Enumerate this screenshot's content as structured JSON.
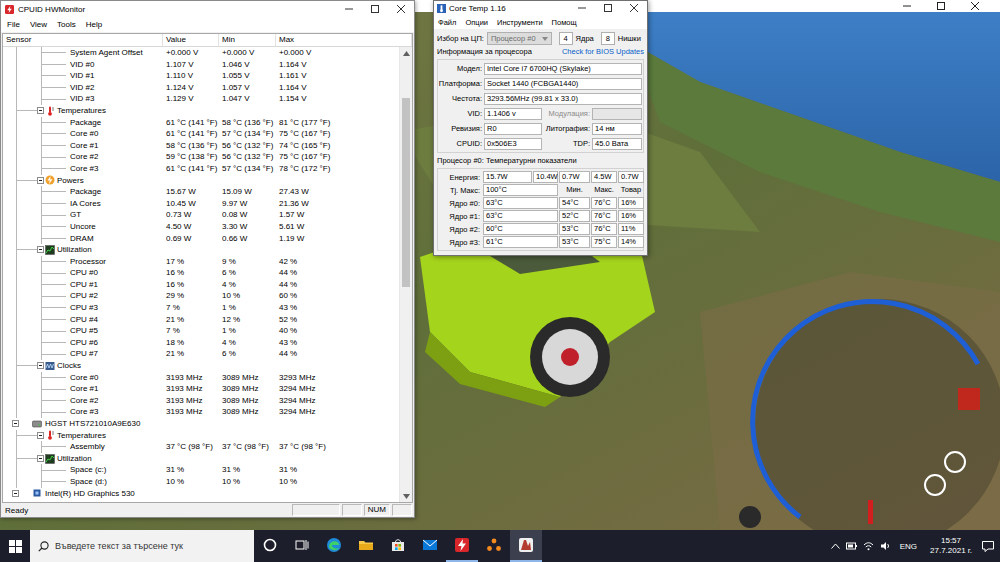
{
  "hwmonitor": {
    "title": "CPUID HWMonitor",
    "menu": [
      "File",
      "View",
      "Tools",
      "Help"
    ],
    "columns": [
      "Sensor",
      "Value",
      "Min",
      "Max"
    ],
    "rows": [
      {
        "kind": "sensor",
        "label": "System Agent Offset",
        "value": "+0.000 V",
        "min": "+0.000 V",
        "max": "+0.000 V"
      },
      {
        "kind": "sensor",
        "label": "VID #0",
        "value": "1.107 V",
        "min": "1.046 V",
        "max": "1.164 V"
      },
      {
        "kind": "sensor",
        "label": "VID #1",
        "value": "1.110 V",
        "min": "1.055 V",
        "max": "1.161 V"
      },
      {
        "kind": "sensor",
        "label": "VID #2",
        "value": "1.124 V",
        "min": "1.057 V",
        "max": "1.164 V"
      },
      {
        "kind": "sensor",
        "label": "VID #3",
        "value": "1.129 V",
        "min": "1.047 V",
        "max": "1.154 V"
      },
      {
        "kind": "temperatures",
        "label": "Temperatures",
        "expanded": true
      },
      {
        "kind": "sensor",
        "label": "Package",
        "value": "61 °C (141 °F)",
        "min": "58 °C (136 °F)",
        "max": "81 °C (177 °F)"
      },
      {
        "kind": "sensor",
        "label": "Core #0",
        "value": "61 °C (141 °F)",
        "min": "57 °C (134 °F)",
        "max": "75 °C (167 °F)"
      },
      {
        "kind": "sensor",
        "label": "Core #1",
        "value": "58 °C (136 °F)",
        "min": "56 °C (132 °F)",
        "max": "74 °C (165 °F)"
      },
      {
        "kind": "sensor",
        "label": "Core #2",
        "value": "59 °C (138 °F)",
        "min": "56 °C (132 °F)",
        "max": "75 °C (167 °F)"
      },
      {
        "kind": "sensor",
        "label": "Core #3",
        "value": "61 °C (141 °F)",
        "min": "57 °C (134 °F)",
        "max": "78 °C (172 °F)"
      },
      {
        "kind": "powers",
        "label": "Powers",
        "expanded": true
      },
      {
        "kind": "sensor",
        "label": "Package",
        "value": "15.67 W",
        "min": "15.09 W",
        "max": "27.43 W"
      },
      {
        "kind": "sensor",
        "label": "IA Cores",
        "value": "10.45 W",
        "min": "9.97 W",
        "max": "21.36 W"
      },
      {
        "kind": "sensor",
        "label": "GT",
        "value": "0.73 W",
        "min": "0.08 W",
        "max": "1.57 W"
      },
      {
        "kind": "sensor",
        "label": "Uncore",
        "value": "4.50 W",
        "min": "3.30 W",
        "max": "5.61 W"
      },
      {
        "kind": "sensor",
        "label": "DRAM",
        "value": "0.69 W",
        "min": "0.66 W",
        "max": "1.19 W"
      },
      {
        "kind": "utilization",
        "label": "Utilization",
        "expanded": true
      },
      {
        "kind": "sensor",
        "label": "Processor",
        "value": "17 %",
        "min": "9 %",
        "max": "42 %"
      },
      {
        "kind": "sensor",
        "label": "CPU #0",
        "value": "16 %",
        "min": "6 %",
        "max": "44 %"
      },
      {
        "kind": "sensor",
        "label": "CPU #1",
        "value": "16 %",
        "min": "4 %",
        "max": "44 %"
      },
      {
        "kind": "sensor",
        "label": "CPU #2",
        "value": "29 %",
        "min": "10 %",
        "max": "60 %"
      },
      {
        "kind": "sensor",
        "label": "CPU #3",
        "value": "7 %",
        "min": "1 %",
        "max": "43 %"
      },
      {
        "kind": "sensor",
        "label": "CPU #4",
        "value": "21 %",
        "min": "12 %",
        "max": "52 %"
      },
      {
        "kind": "sensor",
        "label": "CPU #5",
        "value": "7 %",
        "min": "1 %",
        "max": "40 %"
      },
      {
        "kind": "sensor",
        "label": "CPU #6",
        "value": "18 %",
        "min": "4 %",
        "max": "43 %"
      },
      {
        "kind": "sensor",
        "label": "CPU #7",
        "value": "21 %",
        "min": "6 %",
        "max": "44 %"
      },
      {
        "kind": "clocks",
        "label": "Clocks",
        "expanded": true
      },
      {
        "kind": "sensor",
        "label": "Core #0",
        "value": "3193 MHz",
        "min": "3089 MHz",
        "max": "3293 MHz"
      },
      {
        "kind": "sensor",
        "label": "Core #1",
        "value": "3193 MHz",
        "min": "3089 MHz",
        "max": "3294 MHz"
      },
      {
        "kind": "sensor",
        "label": "Core #2",
        "value": "3193 MHz",
        "min": "3089 MHz",
        "max": "3294 MHz"
      },
      {
        "kind": "sensor",
        "label": "Core #3",
        "value": "3193 MHz",
        "min": "3089 MHz",
        "max": "3294 MHz"
      },
      {
        "kind": "drive",
        "label": "HGST HTS721010A9E630",
        "expanded": true
      },
      {
        "kind": "temperatures",
        "label": "Temperatures",
        "expanded": true
      },
      {
        "kind": "sensor",
        "label": "Assembly",
        "value": "37 °C (98 °F)",
        "min": "37 °C (98 °F)",
        "max": "37 °C (98 °F)"
      },
      {
        "kind": "utilization",
        "label": "Utilization",
        "expanded": true
      },
      {
        "kind": "sensor",
        "label": "Space (c:)",
        "value": "31 %",
        "min": "31 %",
        "max": "31 %"
      },
      {
        "kind": "sensor",
        "label": "Space (d:)",
        "value": "10 %",
        "min": "10 %",
        "max": "10 %"
      },
      {
        "kind": "gpu",
        "label": "Intel(R) HD Graphics 530",
        "expanded": true
      }
    ],
    "scrollbar": {
      "position": 0.09,
      "level": 0.44
    },
    "status_bar": {
      "text": "Ready",
      "indicator": "NUM"
    }
  },
  "coretemp": {
    "title": "Core Temp 1.16",
    "menu": [
      "Файл",
      "Опции",
      "Инструменти",
      "Помощ"
    ],
    "cpu_select": {
      "label": "Избор на ЦП:",
      "value": "Процесор #0",
      "disabled": true
    },
    "cores": {
      "value": "4",
      "label": "Ядра"
    },
    "threads": {
      "value": "8",
      "label": "Нишки"
    },
    "info_title": "Информация за процесора",
    "bios_link": "Check for BIOS Updates",
    "info_full": [
      {
        "label": "Модел:",
        "value": "Intel Core i7 6700HQ (Skylake)"
      },
      {
        "label": "Платформа:",
        "value": "Socket 1440 (FCBGA1440)"
      },
      {
        "label": "Честота:",
        "value": "3293.56MHz (99.81 x 33.0)"
      }
    ],
    "info_pairs": [
      {
        "label": "VID:",
        "value": "1.1406 v",
        "label2": "Модулация:",
        "value2": "",
        "disabled2": true
      },
      {
        "label": "Ревизия:",
        "value": "R0",
        "label2": "Литография:",
        "value2": "14 нм",
        "disabled2": false
      },
      {
        "label": "CPUID:",
        "value": "0x506E3",
        "label2": "TDP:",
        "value2": "45.0 Вата",
        "disabled2": false
      }
    ],
    "temp_title": "Процесор #0: Температурни показатели",
    "power": {
      "label": "Енергия:",
      "values": [
        "15.7W",
        "10.4W",
        "0.7W",
        "4.5W",
        "0.7W"
      ]
    },
    "tjmax": {
      "label": "Tj. Макс:",
      "value": "100°C"
    },
    "temp_columns": [
      "Мин.",
      "Макс.",
      "Товар"
    ],
    "core_rows": [
      {
        "label": "Ядро #0:",
        "temp": "63°C",
        "min": "54°C",
        "max": "76°C",
        "load": "16%"
      },
      {
        "label": "Ядро #1:",
        "temp": "63°C",
        "min": "52°C",
        "max": "76°C",
        "load": "16%"
      },
      {
        "label": "Ядро #2:",
        "temp": "60°C",
        "min": "53°C",
        "max": "76°C",
        "load": "11%"
      },
      {
        "label": "Ядро #3:",
        "temp": "61°C",
        "min": "53°C",
        "max": "75°C",
        "load": "14%"
      }
    ]
  },
  "taskbar": {
    "search": {
      "placeholder": "Въведете текст за търсене тук"
    },
    "apps": [
      {
        "kind": "cortana",
        "running": false,
        "selected": false
      },
      {
        "kind": "taskview",
        "running": false,
        "selected": false
      },
      {
        "kind": "edge",
        "running": false,
        "selected": false
      },
      {
        "kind": "explorer",
        "running": false,
        "selected": false
      },
      {
        "kind": "store",
        "running": false,
        "selected": false
      },
      {
        "kind": "mail",
        "running": false,
        "selected": false
      },
      {
        "kind": "hwmonitor",
        "running": true,
        "selected": false
      },
      {
        "kind": "app",
        "running": false,
        "selected": false
      },
      {
        "kind": "game",
        "running": true,
        "selected": true
      }
    ],
    "tray": {
      "language": "ENG",
      "time": "15:57",
      "date": "27.7.2021 г."
    }
  }
}
